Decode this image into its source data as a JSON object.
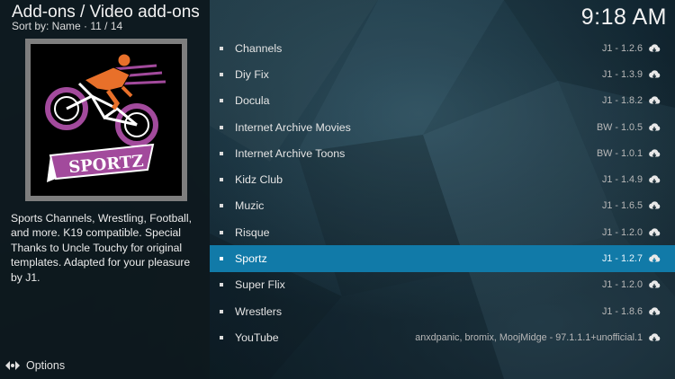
{
  "header": {
    "title": "Add-ons / Video add-ons",
    "sort_label": "Sort by: Name  ·  11 / 14",
    "clock": "9:18 AM"
  },
  "poster": {
    "logo_text": "SPORTZ"
  },
  "description": "Sports Channels, Wrestling, Football, and more. K19 compatible. Special Thanks to Uncle Touchy for original templates. Adapted for your pleasure by J1.",
  "footer": {
    "options_label": "Options"
  },
  "addons": [
    {
      "name": "Channels",
      "version": "J1 - 1.2.6",
      "focused": false
    },
    {
      "name": "Diy Fix",
      "version": "J1 - 1.3.9",
      "focused": false
    },
    {
      "name": "Docula",
      "version": "J1 - 1.8.2",
      "focused": false
    },
    {
      "name": "Internet Archive Movies",
      "version": "BW - 1.0.5",
      "focused": false
    },
    {
      "name": "Internet Archive Toons",
      "version": "BW - 1.0.1",
      "focused": false
    },
    {
      "name": "Kidz Club",
      "version": "J1 - 1.4.9",
      "focused": false
    },
    {
      "name": "Muzic",
      "version": "J1 - 1.6.5",
      "focused": false
    },
    {
      "name": "Risque",
      "version": "J1 - 1.2.0",
      "focused": false
    },
    {
      "name": "Sportz",
      "version": "J1 - 1.2.7",
      "focused": true
    },
    {
      "name": "Super Flix",
      "version": "J1 - 1.2.0",
      "focused": false
    },
    {
      "name": "Wrestlers",
      "version": "J1 - 1.8.6",
      "focused": false
    },
    {
      "name": "YouTube",
      "version": "anxdpanic, bromix, MoojMidge - 97.1.1.1+unofficial.1",
      "focused": false
    }
  ],
  "colors": {
    "focus": "#117aa8",
    "panel": "#0e181e",
    "poster_border": "#7e7e7e",
    "logo_purple": "#a24a9c",
    "logo_orange": "#e8702a"
  }
}
